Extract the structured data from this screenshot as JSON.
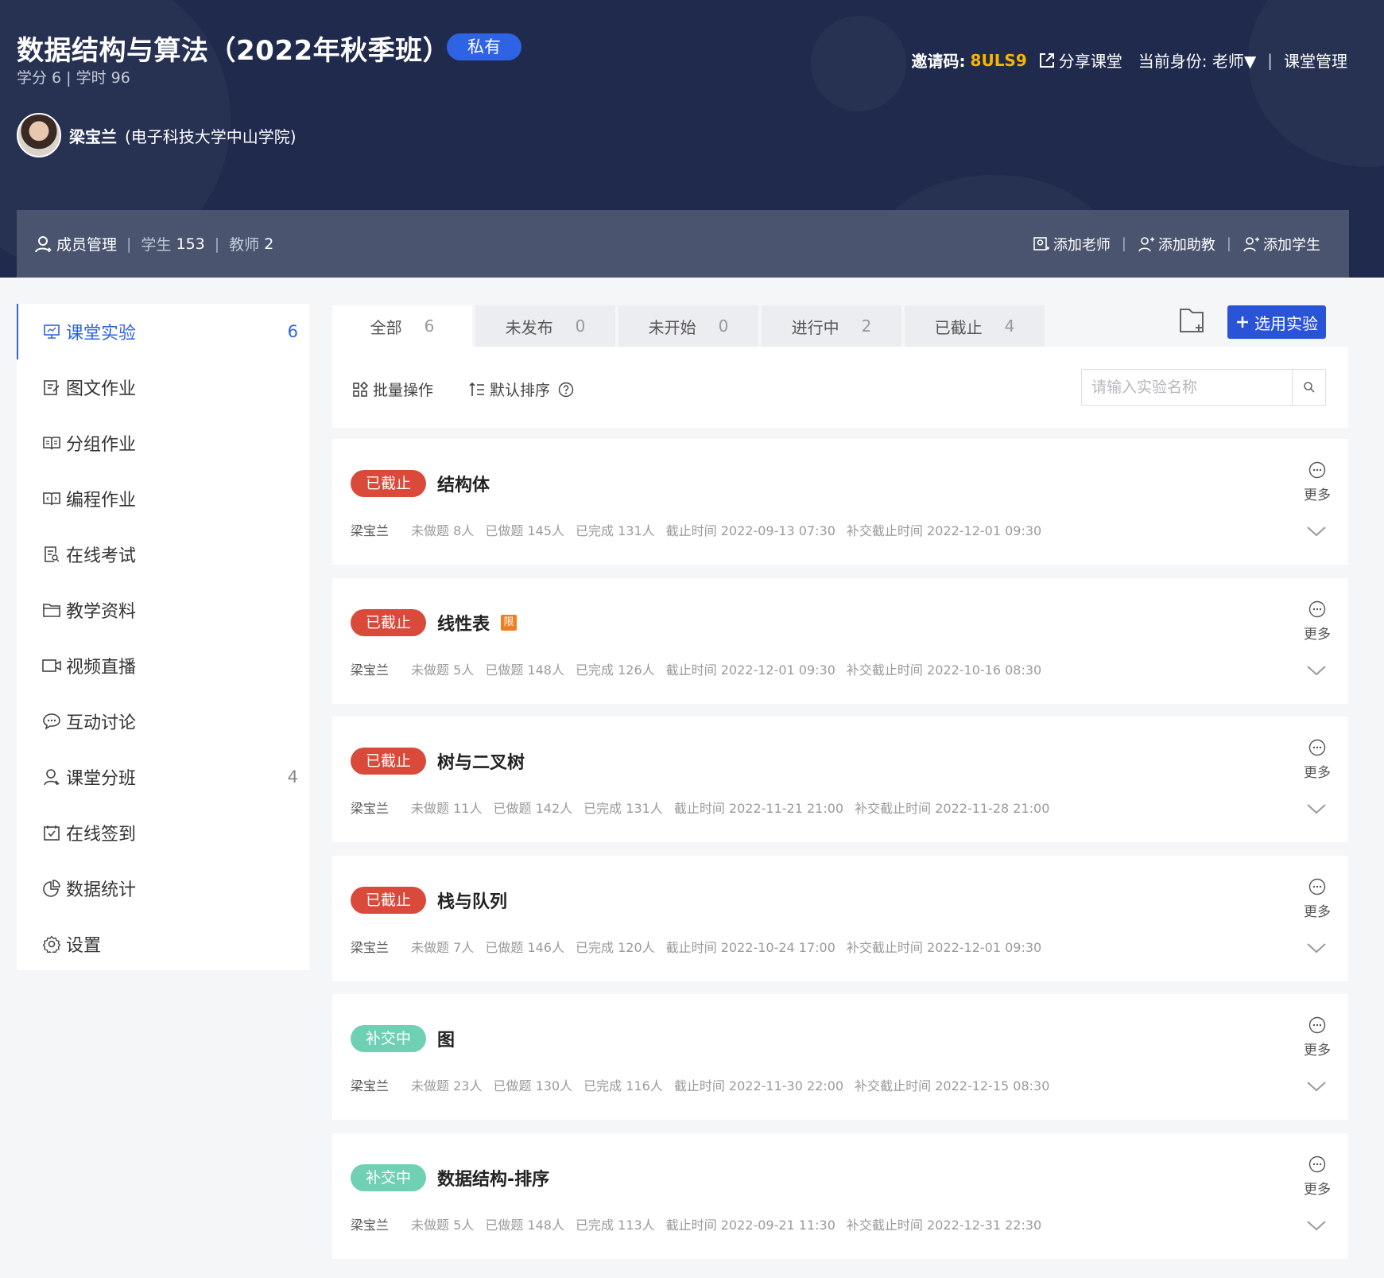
{
  "course": {
    "title": "数据结构与算法（2022年秋季班）",
    "visibility": "私有",
    "meta": "学分 6 | 学时 96"
  },
  "topbar": {
    "invite_label": "邀请码:",
    "invite_code": "8ULS9",
    "share": "分享课堂",
    "identity": "当前身份: 老师▼",
    "manage": "课堂管理"
  },
  "teacher": {
    "name": "梁宝兰",
    "school": "(电子科技大学中山学院)"
  },
  "members": {
    "title": "成员管理",
    "students_label": "学生",
    "students": "153",
    "teachers_label": "教师",
    "teachers": "2",
    "add_teacher": "添加老师",
    "add_ta": "添加助教",
    "add_student": "添加学生"
  },
  "sidebar": {
    "items": [
      {
        "label": "课堂实验",
        "count": "6",
        "icon": "monitor-icon"
      },
      {
        "label": "图文作业",
        "count": "",
        "icon": "edit-doc-icon"
      },
      {
        "label": "分组作业",
        "count": "",
        "icon": "book-open-icon"
      },
      {
        "label": "编程作业",
        "count": "",
        "icon": "code-icon"
      },
      {
        "label": "在线考试",
        "count": "",
        "icon": "exam-icon"
      },
      {
        "label": "教学资料",
        "count": "",
        "icon": "folder-icon"
      },
      {
        "label": "视频直播",
        "count": "",
        "icon": "video-icon"
      },
      {
        "label": "互动讨论",
        "count": "",
        "icon": "chat-icon"
      },
      {
        "label": "课堂分班",
        "count": "4",
        "icon": "user-icon"
      },
      {
        "label": "在线签到",
        "count": "",
        "icon": "calendar-check-icon"
      },
      {
        "label": "数据统计",
        "count": "",
        "icon": "pie-chart-icon"
      },
      {
        "label": "设置",
        "count": "",
        "icon": "gear-icon"
      }
    ]
  },
  "tabs": [
    {
      "label": "全部",
      "count": "6"
    },
    {
      "label": "未发布",
      "count": "0"
    },
    {
      "label": "未开始",
      "count": "0"
    },
    {
      "label": "进行中",
      "count": "2"
    },
    {
      "label": "已截止",
      "count": "4"
    }
  ],
  "actions": {
    "select": "选用实验",
    "batch": "批量操作",
    "sort": "默认排序",
    "search_placeholder": "请输入实验名称"
  },
  "labels": {
    "more": "更多",
    "not_done": "未做题",
    "done": "已做题",
    "completed": "已完成",
    "deadline": "截止时间",
    "makeup_deadline": "补交截止时间"
  },
  "experiments": [
    {
      "status": "已截止",
      "status_type": "closed",
      "name": "结构体",
      "limited": "",
      "author": "梁宝兰",
      "not_done": "8人",
      "done": "145人",
      "completed": "131人",
      "deadline": "2022-09-13 07:30",
      "makeup": "2022-12-01 09:30"
    },
    {
      "status": "已截止",
      "status_type": "closed",
      "name": "线性表",
      "limited": "限",
      "author": "梁宝兰",
      "not_done": "5人",
      "done": "148人",
      "completed": "126人",
      "deadline": "2022-12-01 09:30",
      "makeup": "2022-10-16 08:30"
    },
    {
      "status": "已截止",
      "status_type": "closed",
      "name": "树与二叉树",
      "limited": "",
      "author": "梁宝兰",
      "not_done": "11人",
      "done": "142人",
      "completed": "131人",
      "deadline": "2022-11-21 21:00",
      "makeup": "2022-11-28 21:00"
    },
    {
      "status": "已截止",
      "status_type": "closed",
      "name": "栈与队列",
      "limited": "",
      "author": "梁宝兰",
      "not_done": "7人",
      "done": "146人",
      "completed": "120人",
      "deadline": "2022-10-24 17:00",
      "makeup": "2022-12-01 09:30"
    },
    {
      "status": "补交中",
      "status_type": "makeup",
      "name": "图",
      "limited": "",
      "author": "梁宝兰",
      "not_done": "23人",
      "done": "130人",
      "completed": "116人",
      "deadline": "2022-11-30 22:00",
      "makeup": "2022-12-15 08:30"
    },
    {
      "status": "补交中",
      "status_type": "makeup",
      "name": "数据结构-排序",
      "limited": "",
      "author": "梁宝兰",
      "not_done": "5人",
      "done": "148人",
      "completed": "113人",
      "deadline": "2022-09-21 11:30",
      "makeup": "2022-12-31 22:30"
    }
  ],
  "colors": {
    "header_bg": "#1f2a4d",
    "accent": "#2e63e4",
    "closed": "#d94a3a",
    "makeup": "#6fd0b4",
    "invite_code": "#f7b500"
  }
}
